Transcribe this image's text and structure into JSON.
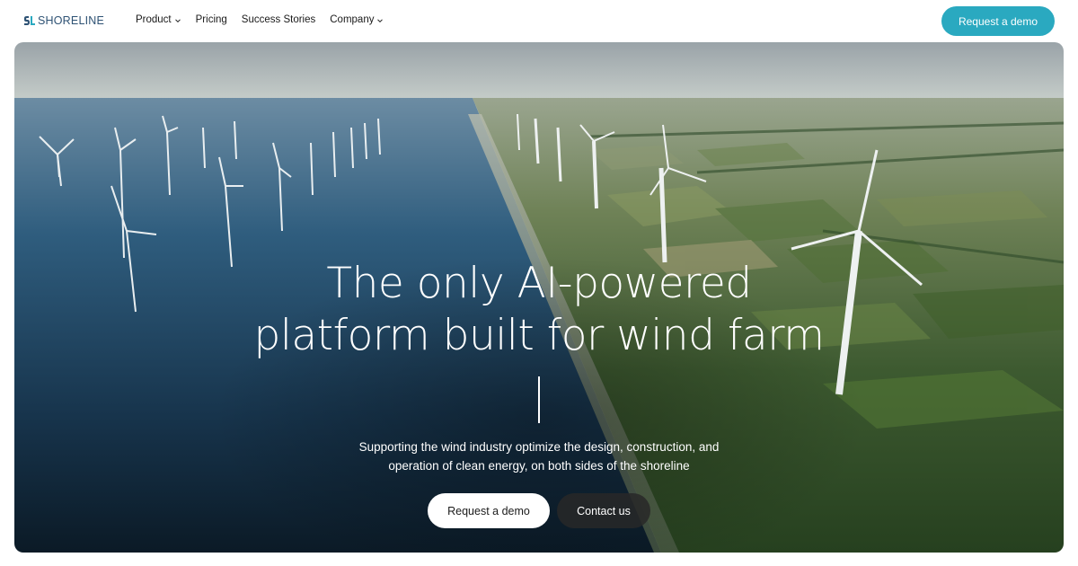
{
  "brand": {
    "name": "SHORELINE",
    "logo_icon": "shoreline-logo-mark",
    "color": "#2e5274"
  },
  "nav": {
    "items": [
      {
        "label": "Product",
        "has_dropdown": true,
        "icon": "chevron-down-icon"
      },
      {
        "label": "Pricing",
        "has_dropdown": false
      },
      {
        "label": "Success Stories",
        "has_dropdown": false
      },
      {
        "label": "Company",
        "has_dropdown": true,
        "icon": "chevron-down-icon"
      }
    ],
    "cta_label": "Request a demo"
  },
  "hero": {
    "title_line1": "The only AI-powered",
    "title_line2": "platform built for wind farm",
    "subtitle_line1": "Supporting the wind industry optimize the design, construction, and",
    "subtitle_line2": "operation of clean energy, on both sides of the shoreline",
    "primary_button": "Request a demo",
    "secondary_button": "Contact us",
    "background": "aerial-photo-offshore-and-onshore-wind-turbines"
  },
  "colors": {
    "accent": "#2aa9c0",
    "text_dark": "#1b1b1b",
    "secondary_button": "#282828"
  }
}
